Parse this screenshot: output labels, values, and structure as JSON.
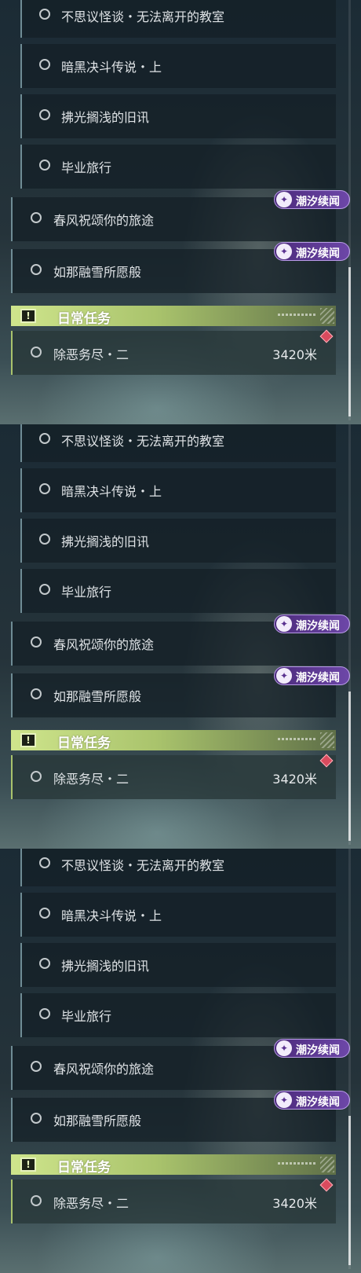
{
  "quests": {
    "sub": [
      "不思议怪谈・无法离开的教室",
      "暗黑决斗传说・上",
      "拂光搁浅的旧讯",
      "毕业旅行"
    ],
    "top": [
      "春风祝颂你的旅途",
      "如那融雪所愿般"
    ]
  },
  "badge": {
    "label": "潮汐续闻",
    "icon": "tide-badge-icon"
  },
  "daily": {
    "title": "日常任务",
    "quest_name": "除恶务尽・二",
    "distance": "3420米",
    "header_icon": "alert-icon",
    "marker_icon": "location-marker-icon"
  },
  "colors": {
    "daily_accent": "#a9c36c",
    "badge_purple": "#6d47a8",
    "marker_red": "#d94b5e"
  }
}
